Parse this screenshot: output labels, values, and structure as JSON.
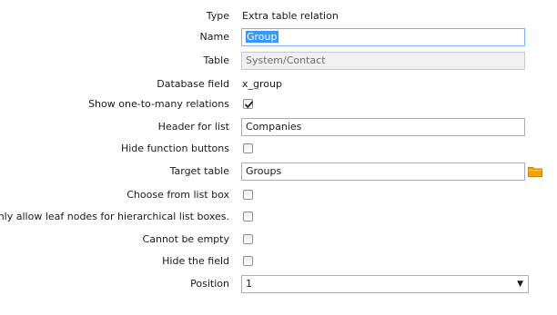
{
  "fields": {
    "type": {
      "label": "Type",
      "value": "Extra table relation"
    },
    "name": {
      "label": "Name",
      "value": "Group"
    },
    "table": {
      "label": "Table",
      "value": "System/Contact"
    },
    "database_field": {
      "label": "Database field",
      "value": "x_group"
    },
    "show_one_to_many": {
      "label": "Show one-to-many relations",
      "checked": true
    },
    "header_for_list": {
      "label": "Header for list",
      "value": "Companies"
    },
    "hide_function_buttons": {
      "label": "Hide function buttons",
      "checked": false
    },
    "target_table": {
      "label": "Target table",
      "value": "Groups",
      "icon": "folder-icon"
    },
    "choose_from_list_box": {
      "label": "Choose from list box",
      "checked": false
    },
    "only_leaf_nodes": {
      "label": "Only allow leaf nodes for hierarchical list boxes.",
      "checked": false
    },
    "cannot_be_empty": {
      "label": "Cannot be empty",
      "checked": false
    },
    "hide_the_field": {
      "label": "Hide the field",
      "checked": false
    },
    "position": {
      "label": "Position",
      "value": "1"
    }
  },
  "colors": {
    "folder": "#f0a30a",
    "selection": "#3399ff",
    "focus_border": "#7eb4ea"
  }
}
